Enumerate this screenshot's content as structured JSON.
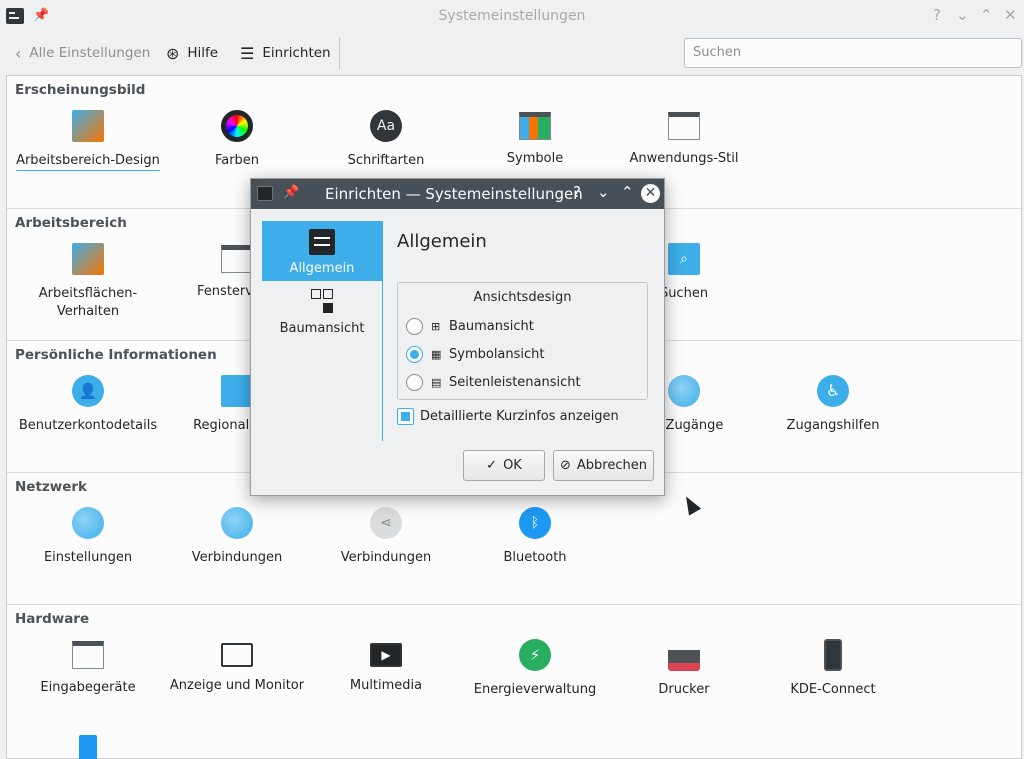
{
  "window": {
    "title": "Systemeinstellungen",
    "help_glyph": "?",
    "minimize_glyph": "⌄",
    "maximize_glyph": "⌃"
  },
  "toolbar": {
    "back_label": "Alle Einstellungen",
    "help_label": "Hilfe",
    "configure_label": "Einrichten",
    "search_placeholder": "Suchen"
  },
  "sections": [
    {
      "title": "Erscheinungsbild",
      "items": [
        {
          "label": "Arbeitsbereich-Design",
          "icon": "workspace-theme-icon"
        },
        {
          "label": "Farben",
          "icon": "colors-icon"
        },
        {
          "label": "Schriftarten",
          "icon": "fonts-icon"
        },
        {
          "label": "Symbole",
          "icon": "icons-icon"
        },
        {
          "label": "Anwendungs-Stil",
          "icon": "application-style-icon"
        }
      ]
    },
    {
      "title": "Arbeitsbereich",
      "items": [
        {
          "label": "Arbeitsflächen-\nVerhalten",
          "icon": "desktop-behavior-icon"
        },
        {
          "label": "Fensterverw",
          "icon": "window-management-icon"
        },
        {
          "label": "Suchen",
          "icon": "search-icon"
        }
      ]
    },
    {
      "title": "Persönliche Informationen",
      "items": [
        {
          "label": "Benutzerkontodetails",
          "icon": "user-account-icon"
        },
        {
          "label": "Regionaleinst",
          "icon": "regional-settings-icon"
        },
        {
          "label": "ne-Zugänge",
          "icon": "online-accounts-icon"
        },
        {
          "label": "Zugangshilfen",
          "icon": "accessibility-icon"
        }
      ]
    },
    {
      "title": "Netzwerk",
      "items": [
        {
          "label": "Einstellungen",
          "icon": "network-settings-icon"
        },
        {
          "label": "Verbindungen",
          "icon": "connections-icon"
        },
        {
          "label": "Verbindungen",
          "icon": "sharing-connections-icon"
        },
        {
          "label": "Bluetooth",
          "icon": "bluetooth-icon"
        }
      ]
    },
    {
      "title": "Hardware",
      "items": [
        {
          "label": "Eingabegeräte",
          "icon": "input-devices-icon"
        },
        {
          "label": "Anzeige und Monitor",
          "icon": "display-monitor-icon"
        },
        {
          "label": "Multimedia",
          "icon": "multimedia-icon"
        },
        {
          "label": "Energieverwaltung",
          "icon": "power-management-icon"
        },
        {
          "label": "Drucker",
          "icon": "printer-icon"
        },
        {
          "label": "KDE-Connect",
          "icon": "kde-connect-icon"
        }
      ]
    }
  ],
  "dialog": {
    "title": "Einrichten — Systemeinstellungen",
    "help_glyph": "?",
    "minimize_glyph": "⌄",
    "maximize_glyph": "⌃",
    "close_glyph": "✕",
    "side_items": [
      {
        "label": "Allgemein",
        "active": true
      },
      {
        "label": "Baumansicht",
        "active": false
      }
    ],
    "heading": "Allgemein",
    "group_title": "Ansichtsdesign",
    "radios": [
      {
        "label": "Baumansicht",
        "checked": false
      },
      {
        "label": "Symbolansicht",
        "checked": true
      },
      {
        "label": "Seitenleistenansicht",
        "checked": false
      }
    ],
    "checkbox_label": "Detaillierte Kurzinfos anzeigen",
    "checkbox_checked": true,
    "ok_label": "OK",
    "cancel_label": "Abbrechen"
  },
  "colors": {
    "accent": "#3daee9",
    "dialog_titlebar": "#475057",
    "background": "#eff0f1"
  }
}
